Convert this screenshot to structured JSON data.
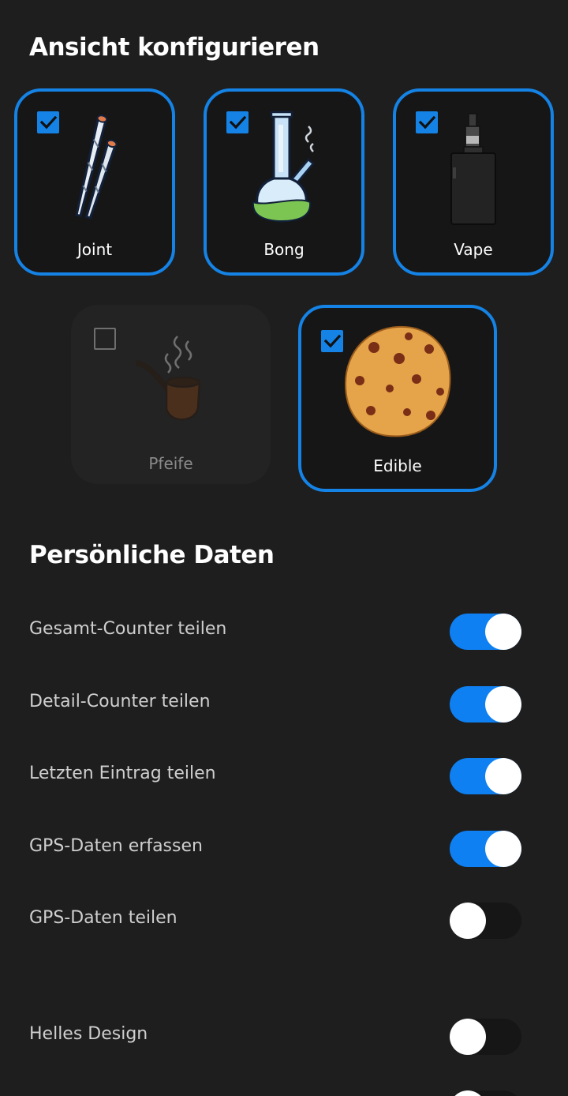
{
  "sections": {
    "view_title": "Ansicht konfigurieren",
    "personal_title": "Persönliche Daten"
  },
  "tiles": [
    {
      "label": "Joint",
      "checked": true,
      "icon": "joint-icon"
    },
    {
      "label": "Bong",
      "checked": true,
      "icon": "bong-icon"
    },
    {
      "label": "Vape",
      "checked": true,
      "icon": "vape-icon"
    },
    {
      "label": "Pfeife",
      "checked": false,
      "icon": "pipe-icon"
    },
    {
      "label": "Edible",
      "checked": true,
      "icon": "cookie-icon"
    }
  ],
  "settings": [
    {
      "label": "Gesamt-Counter teilen",
      "on": true
    },
    {
      "label": "Detail-Counter teilen",
      "on": true
    },
    {
      "label": "Letzten Eintrag teilen",
      "on": true
    },
    {
      "label": "GPS-Daten erfassen",
      "on": true
    },
    {
      "label": "GPS-Daten teilen",
      "on": false
    },
    {
      "label": "Helles Design",
      "on": false
    }
  ],
  "colors": {
    "background": "#1e1e1e",
    "accent": "#1583e6",
    "toggle_on": "#0e80f2",
    "label": "#cfcfcf"
  }
}
